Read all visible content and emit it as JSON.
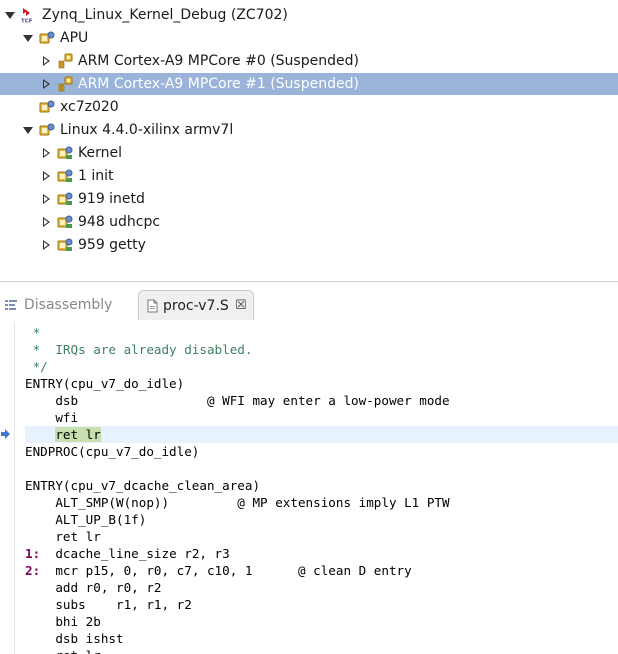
{
  "tree": {
    "nodes": [
      {
        "label": "Zynq_Linux_Kernel_Debug (ZC702)",
        "twisty": "open",
        "icon": "tcf-launch-icon"
      },
      {
        "label": "APU",
        "twisty": "open",
        "icon": "debug-context-icon"
      },
      {
        "label": "ARM Cortex-A9 MPCore #0 (Suspended)",
        "twisty": "closed",
        "icon": "suspended-core-icon"
      },
      {
        "label": "ARM Cortex-A9 MPCore #1 (Suspended)",
        "twisty": "closed",
        "icon": "suspended-core-icon",
        "selected": true
      },
      {
        "label": "xc7z020",
        "twisty": "none",
        "icon": "debug-context-icon"
      },
      {
        "label": "Linux 4.4.0-xilinx armv7l",
        "twisty": "open",
        "icon": "debug-context-icon"
      },
      {
        "label": "Kernel",
        "twisty": "closed",
        "icon": "process-icon"
      },
      {
        "label": "1 init",
        "twisty": "closed",
        "icon": "process-icon"
      },
      {
        "label": "919 inetd",
        "twisty": "closed",
        "icon": "process-icon"
      },
      {
        "label": "948 udhcpc",
        "twisty": "closed",
        "icon": "process-icon"
      },
      {
        "label": "959 getty",
        "twisty": "closed",
        "icon": "process-icon"
      }
    ]
  },
  "tabs": {
    "disassembly": "Disassembly",
    "source_file": "proc-v7.S",
    "close_glyph": "☒"
  },
  "code": {
    "lines": [
      " *",
      " *  IRQs are already disabled.",
      " */",
      "ENTRY(cpu_v7_do_idle)",
      "    dsb                 @ WFI may enter a low-power mode",
      "    wfi",
      "    ret lr",
      "ENDPROC(cpu_v7_do_idle)",
      "",
      "ENTRY(cpu_v7_dcache_clean_area)",
      "    ALT_SMP(W(nop))         @ MP extensions imply L1 PTW",
      "    ALT_UP_B(1f)",
      "    ret lr",
      "1:  dcache_line_size r2, r3",
      "2:  mcr p15, 0, r0, c7, c10, 1      @ clean D entry",
      "    add r0, r0, r2",
      "    subs    r1, r1, r2",
      "    bhi 2b",
      "    dsb ishst",
      "    ret lr"
    ],
    "current_line_index": 6
  },
  "colors": {
    "selection": "#99b4d8",
    "current_line": "#e8f2fe",
    "comment": "#3f7f5f",
    "label": "#7f0055"
  }
}
